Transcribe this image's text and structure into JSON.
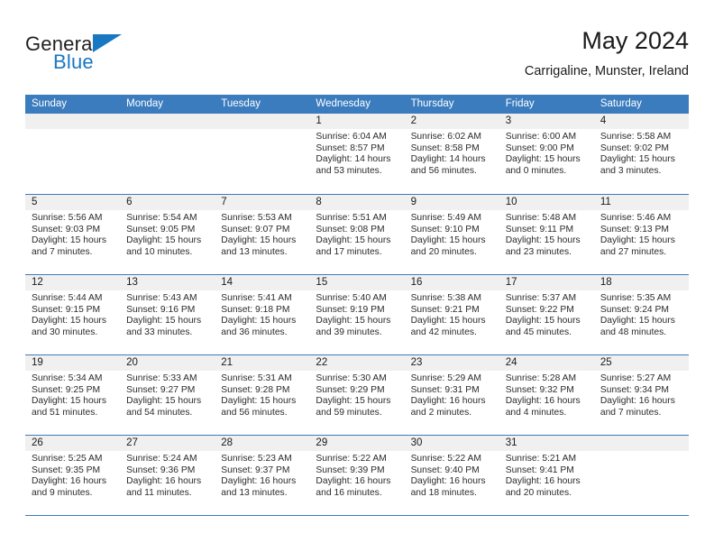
{
  "brand": {
    "name_top": "General",
    "name_bottom": "Blue",
    "accent_color": "#1878c2",
    "triangle_icon": "triangle-icon"
  },
  "header": {
    "month_title": "May 2024",
    "location": "Carrigaline, Munster, Ireland"
  },
  "theme": {
    "header_blue": "#3b7cbe",
    "date_strip_gray": "#f0f0f0",
    "text_color": "#1a1a1a"
  },
  "weekday_headers": [
    "Sunday",
    "Monday",
    "Tuesday",
    "Wednesday",
    "Thursday",
    "Friday",
    "Saturday"
  ],
  "labels": {
    "sunrise_prefix": "Sunrise:",
    "sunset_prefix": "Sunset:",
    "daylight_prefix": "Daylight:"
  },
  "weeks": [
    [
      {
        "date": "",
        "sunrise": "",
        "sunset": "",
        "daylight_1": "",
        "daylight_2": "",
        "empty": true
      },
      {
        "date": "",
        "sunrise": "",
        "sunset": "",
        "daylight_1": "",
        "daylight_2": "",
        "empty": true
      },
      {
        "date": "",
        "sunrise": "",
        "sunset": "",
        "daylight_1": "",
        "daylight_2": "",
        "empty": true
      },
      {
        "date": "1",
        "sunrise": "Sunrise: 6:04 AM",
        "sunset": "Sunset: 8:57 PM",
        "daylight_1": "Daylight: 14 hours",
        "daylight_2": "and 53 minutes."
      },
      {
        "date": "2",
        "sunrise": "Sunrise: 6:02 AM",
        "sunset": "Sunset: 8:58 PM",
        "daylight_1": "Daylight: 14 hours",
        "daylight_2": "and 56 minutes."
      },
      {
        "date": "3",
        "sunrise": "Sunrise: 6:00 AM",
        "sunset": "Sunset: 9:00 PM",
        "daylight_1": "Daylight: 15 hours",
        "daylight_2": "and 0 minutes."
      },
      {
        "date": "4",
        "sunrise": "Sunrise: 5:58 AM",
        "sunset": "Sunset: 9:02 PM",
        "daylight_1": "Daylight: 15 hours",
        "daylight_2": "and 3 minutes."
      }
    ],
    [
      {
        "date": "5",
        "sunrise": "Sunrise: 5:56 AM",
        "sunset": "Sunset: 9:03 PM",
        "daylight_1": "Daylight: 15 hours",
        "daylight_2": "and 7 minutes."
      },
      {
        "date": "6",
        "sunrise": "Sunrise: 5:54 AM",
        "sunset": "Sunset: 9:05 PM",
        "daylight_1": "Daylight: 15 hours",
        "daylight_2": "and 10 minutes."
      },
      {
        "date": "7",
        "sunrise": "Sunrise: 5:53 AM",
        "sunset": "Sunset: 9:07 PM",
        "daylight_1": "Daylight: 15 hours",
        "daylight_2": "and 13 minutes."
      },
      {
        "date": "8",
        "sunrise": "Sunrise: 5:51 AM",
        "sunset": "Sunset: 9:08 PM",
        "daylight_1": "Daylight: 15 hours",
        "daylight_2": "and 17 minutes."
      },
      {
        "date": "9",
        "sunrise": "Sunrise: 5:49 AM",
        "sunset": "Sunset: 9:10 PM",
        "daylight_1": "Daylight: 15 hours",
        "daylight_2": "and 20 minutes."
      },
      {
        "date": "10",
        "sunrise": "Sunrise: 5:48 AM",
        "sunset": "Sunset: 9:11 PM",
        "daylight_1": "Daylight: 15 hours",
        "daylight_2": "and 23 minutes."
      },
      {
        "date": "11",
        "sunrise": "Sunrise: 5:46 AM",
        "sunset": "Sunset: 9:13 PM",
        "daylight_1": "Daylight: 15 hours",
        "daylight_2": "and 27 minutes."
      }
    ],
    [
      {
        "date": "12",
        "sunrise": "Sunrise: 5:44 AM",
        "sunset": "Sunset: 9:15 PM",
        "daylight_1": "Daylight: 15 hours",
        "daylight_2": "and 30 minutes."
      },
      {
        "date": "13",
        "sunrise": "Sunrise: 5:43 AM",
        "sunset": "Sunset: 9:16 PM",
        "daylight_1": "Daylight: 15 hours",
        "daylight_2": "and 33 minutes."
      },
      {
        "date": "14",
        "sunrise": "Sunrise: 5:41 AM",
        "sunset": "Sunset: 9:18 PM",
        "daylight_1": "Daylight: 15 hours",
        "daylight_2": "and 36 minutes."
      },
      {
        "date": "15",
        "sunrise": "Sunrise: 5:40 AM",
        "sunset": "Sunset: 9:19 PM",
        "daylight_1": "Daylight: 15 hours",
        "daylight_2": "and 39 minutes."
      },
      {
        "date": "16",
        "sunrise": "Sunrise: 5:38 AM",
        "sunset": "Sunset: 9:21 PM",
        "daylight_1": "Daylight: 15 hours",
        "daylight_2": "and 42 minutes."
      },
      {
        "date": "17",
        "sunrise": "Sunrise: 5:37 AM",
        "sunset": "Sunset: 9:22 PM",
        "daylight_1": "Daylight: 15 hours",
        "daylight_2": "and 45 minutes."
      },
      {
        "date": "18",
        "sunrise": "Sunrise: 5:35 AM",
        "sunset": "Sunset: 9:24 PM",
        "daylight_1": "Daylight: 15 hours",
        "daylight_2": "and 48 minutes."
      }
    ],
    [
      {
        "date": "19",
        "sunrise": "Sunrise: 5:34 AM",
        "sunset": "Sunset: 9:25 PM",
        "daylight_1": "Daylight: 15 hours",
        "daylight_2": "and 51 minutes."
      },
      {
        "date": "20",
        "sunrise": "Sunrise: 5:33 AM",
        "sunset": "Sunset: 9:27 PM",
        "daylight_1": "Daylight: 15 hours",
        "daylight_2": "and 54 minutes."
      },
      {
        "date": "21",
        "sunrise": "Sunrise: 5:31 AM",
        "sunset": "Sunset: 9:28 PM",
        "daylight_1": "Daylight: 15 hours",
        "daylight_2": "and 56 minutes."
      },
      {
        "date": "22",
        "sunrise": "Sunrise: 5:30 AM",
        "sunset": "Sunset: 9:29 PM",
        "daylight_1": "Daylight: 15 hours",
        "daylight_2": "and 59 minutes."
      },
      {
        "date": "23",
        "sunrise": "Sunrise: 5:29 AM",
        "sunset": "Sunset: 9:31 PM",
        "daylight_1": "Daylight: 16 hours",
        "daylight_2": "and 2 minutes."
      },
      {
        "date": "24",
        "sunrise": "Sunrise: 5:28 AM",
        "sunset": "Sunset: 9:32 PM",
        "daylight_1": "Daylight: 16 hours",
        "daylight_2": "and 4 minutes."
      },
      {
        "date": "25",
        "sunrise": "Sunrise: 5:27 AM",
        "sunset": "Sunset: 9:34 PM",
        "daylight_1": "Daylight: 16 hours",
        "daylight_2": "and 7 minutes."
      }
    ],
    [
      {
        "date": "26",
        "sunrise": "Sunrise: 5:25 AM",
        "sunset": "Sunset: 9:35 PM",
        "daylight_1": "Daylight: 16 hours",
        "daylight_2": "and 9 minutes."
      },
      {
        "date": "27",
        "sunrise": "Sunrise: 5:24 AM",
        "sunset": "Sunset: 9:36 PM",
        "daylight_1": "Daylight: 16 hours",
        "daylight_2": "and 11 minutes."
      },
      {
        "date": "28",
        "sunrise": "Sunrise: 5:23 AM",
        "sunset": "Sunset: 9:37 PM",
        "daylight_1": "Daylight: 16 hours",
        "daylight_2": "and 13 minutes."
      },
      {
        "date": "29",
        "sunrise": "Sunrise: 5:22 AM",
        "sunset": "Sunset: 9:39 PM",
        "daylight_1": "Daylight: 16 hours",
        "daylight_2": "and 16 minutes."
      },
      {
        "date": "30",
        "sunrise": "Sunrise: 5:22 AM",
        "sunset": "Sunset: 9:40 PM",
        "daylight_1": "Daylight: 16 hours",
        "daylight_2": "and 18 minutes."
      },
      {
        "date": "31",
        "sunrise": "Sunrise: 5:21 AM",
        "sunset": "Sunset: 9:41 PM",
        "daylight_1": "Daylight: 16 hours",
        "daylight_2": "and 20 minutes."
      },
      {
        "date": "",
        "sunrise": "",
        "sunset": "",
        "daylight_1": "",
        "daylight_2": "",
        "empty": true
      }
    ]
  ]
}
